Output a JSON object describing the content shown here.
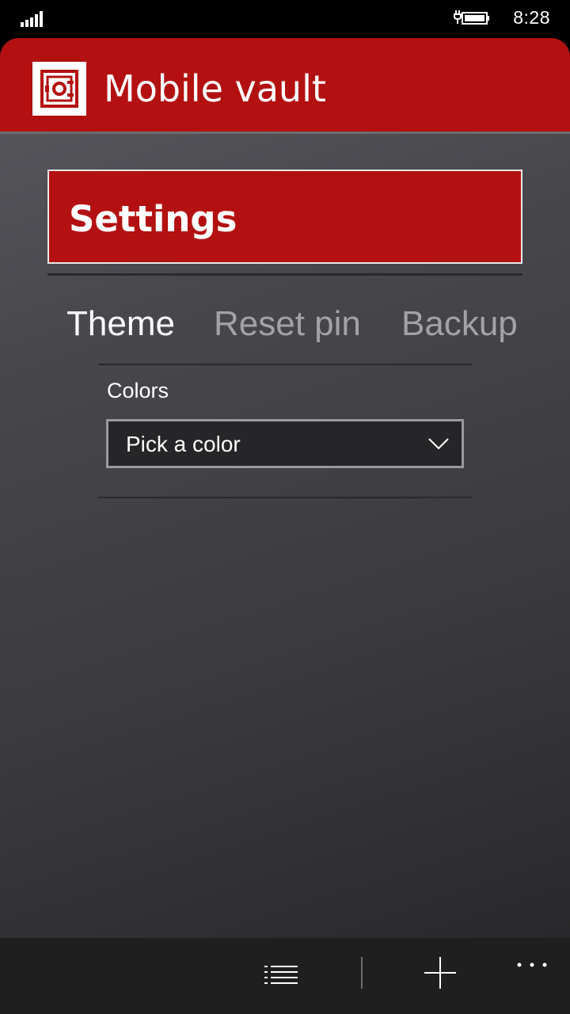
{
  "status_bar": {
    "time": "8:28",
    "signal_icon": "signal-icon",
    "battery_icon": "battery-charging-icon"
  },
  "header": {
    "logo_icon": "vault-icon",
    "title": "Mobile vault"
  },
  "settings": {
    "title": "Settings"
  },
  "tabs": [
    {
      "label": "Theme",
      "active": true
    },
    {
      "label": "Reset pin",
      "active": false
    },
    {
      "label": "Backup",
      "active": false
    }
  ],
  "theme": {
    "colors_label": "Colors",
    "color_select": {
      "value": "Pick a color"
    }
  },
  "app_bar": {
    "icons": [
      "list-icon",
      "add-icon",
      "more-icon"
    ]
  },
  "colors": {
    "accent": "#b31111",
    "header_bg": "#b31111",
    "app_bar_bg": "#1f1f1f"
  }
}
